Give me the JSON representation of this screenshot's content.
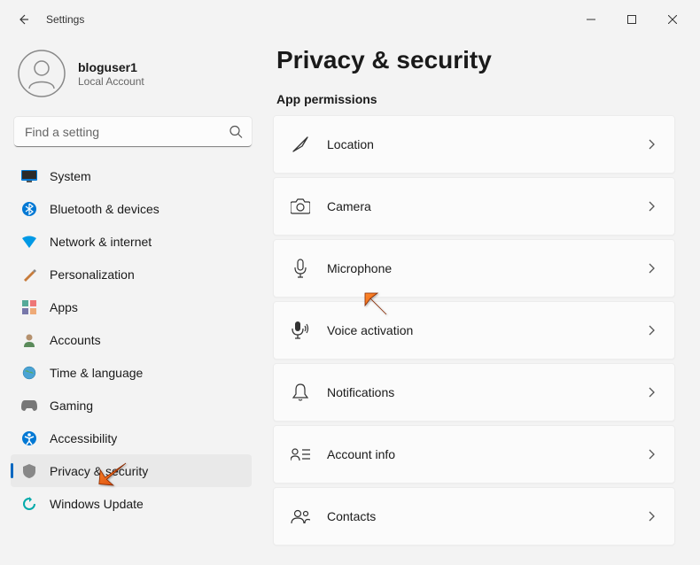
{
  "window": {
    "title": "Settings"
  },
  "profile": {
    "name": "bloguser1",
    "subtitle": "Local Account"
  },
  "search": {
    "placeholder": "Find a setting"
  },
  "sidebar": {
    "items": [
      {
        "label": "System",
        "icon": "system"
      },
      {
        "label": "Bluetooth & devices",
        "icon": "bluetooth"
      },
      {
        "label": "Network & internet",
        "icon": "network"
      },
      {
        "label": "Personalization",
        "icon": "personalization"
      },
      {
        "label": "Apps",
        "icon": "apps"
      },
      {
        "label": "Accounts",
        "icon": "accounts"
      },
      {
        "label": "Time & language",
        "icon": "time"
      },
      {
        "label": "Gaming",
        "icon": "gaming"
      },
      {
        "label": "Accessibility",
        "icon": "accessibility"
      },
      {
        "label": "Privacy & security",
        "icon": "privacy",
        "active": true
      },
      {
        "label": "Windows Update",
        "icon": "update"
      }
    ]
  },
  "main": {
    "page_title": "Privacy & security",
    "section_title": "App permissions",
    "permissions": [
      {
        "label": "Location",
        "icon": "location"
      },
      {
        "label": "Camera",
        "icon": "camera"
      },
      {
        "label": "Microphone",
        "icon": "microphone"
      },
      {
        "label": "Voice activation",
        "icon": "voice"
      },
      {
        "label": "Notifications",
        "icon": "notifications"
      },
      {
        "label": "Account info",
        "icon": "account-info"
      },
      {
        "label": "Contacts",
        "icon": "contacts"
      }
    ]
  }
}
